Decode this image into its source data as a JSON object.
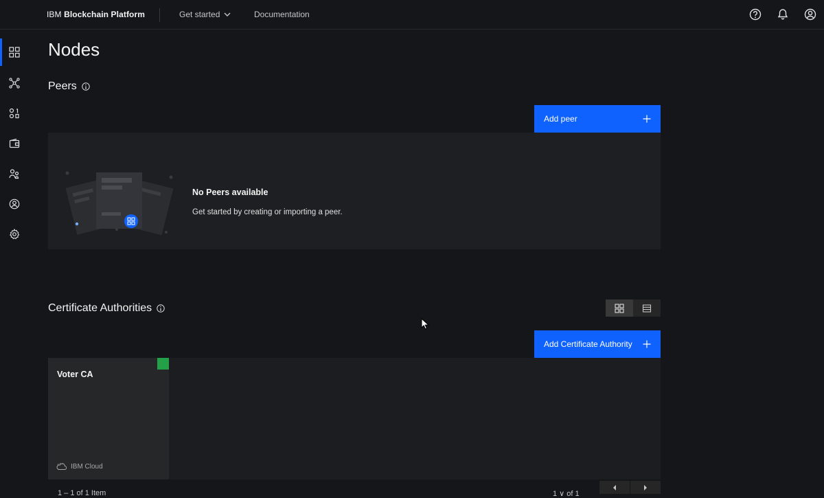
{
  "header": {
    "brand_prefix": "IBM",
    "brand_name": "Blockchain Platform",
    "nav_get_started": "Get started",
    "nav_documentation": "Documentation",
    "icons": [
      "help-icon",
      "notification-icon",
      "user-avatar-icon"
    ]
  },
  "sidebar": {
    "items": [
      {
        "name": "nodes",
        "icon": "grid-icon",
        "active": true
      },
      {
        "name": "channels",
        "icon": "network-icon"
      },
      {
        "name": "smart-contracts",
        "icon": "binary-icon"
      },
      {
        "name": "wallet",
        "icon": "wallet-icon"
      },
      {
        "name": "users",
        "icon": "users-icon"
      },
      {
        "name": "organizations",
        "icon": "user-circle-icon"
      },
      {
        "name": "settings",
        "icon": "gear-icon"
      }
    ]
  },
  "main": {
    "title": "Nodes",
    "peers": {
      "title": "Peers",
      "add_button": "Add peer",
      "empty_title": "No Peers available",
      "empty_desc": "Get started by creating or importing a peer."
    },
    "cas": {
      "title": "Certificate Authorities",
      "add_button": "Add Certificate Authority",
      "tiles": [
        {
          "name": "Voter CA",
          "location": "IBM Cloud",
          "status_color": "#24a148"
        }
      ]
    },
    "pagination": {
      "items_text": "1 – 1 of 1 Item",
      "page_text": "1  ∨  of 1"
    }
  },
  "colors": {
    "accent": "#0f62fe",
    "background": "#151619",
    "status_ok": "#24a148"
  }
}
